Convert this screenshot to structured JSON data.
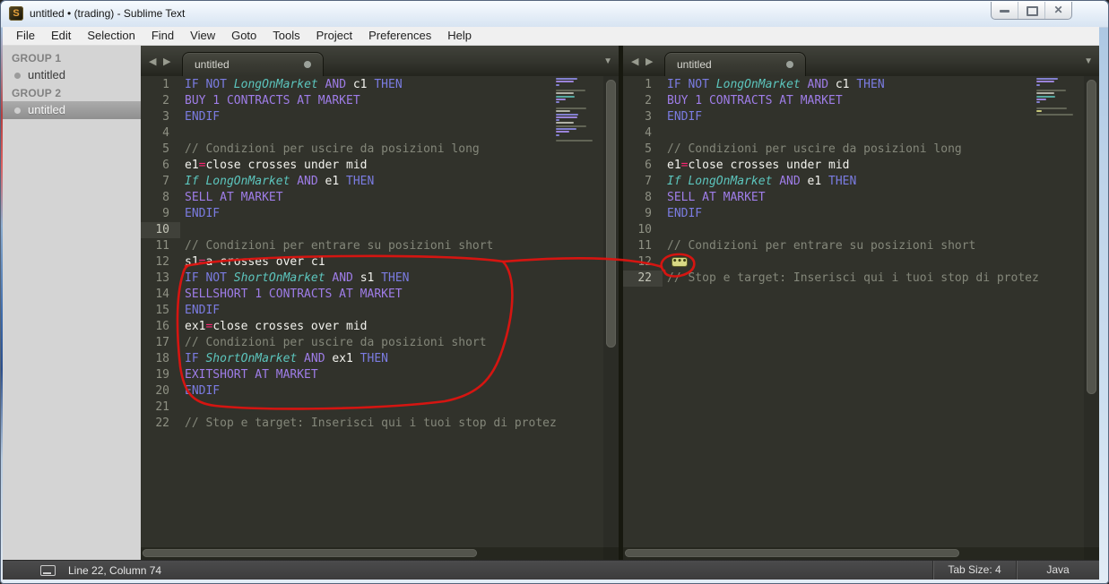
{
  "window": {
    "title": "untitled • (trading) - Sublime Text",
    "controls": {
      "minimize": "minimize",
      "maximize": "maximize",
      "close": "close"
    }
  },
  "menu": {
    "items": [
      "File",
      "Edit",
      "Selection",
      "Find",
      "View",
      "Goto",
      "Tools",
      "Project",
      "Preferences",
      "Help"
    ]
  },
  "sidebar": {
    "groups": [
      {
        "label": "GROUP 1",
        "items": [
          {
            "label": "untitled",
            "selected": false
          }
        ]
      },
      {
        "label": "GROUP 2",
        "items": [
          {
            "label": "untitled",
            "selected": true
          }
        ]
      }
    ]
  },
  "code_lines": {
    "1": [
      [
        "k",
        "IF NOT "
      ],
      [
        "it",
        "LongOnMarket"
      ],
      [
        "k2",
        " AND "
      ],
      [
        "v",
        "c1"
      ],
      [
        "k",
        " THEN"
      ]
    ],
    "2": [
      [
        "k2",
        "BUY 1 CONTRACTS AT MARKET"
      ]
    ],
    "3": [
      [
        "k",
        "ENDIF"
      ]
    ],
    "4": [],
    "5": [
      [
        "c",
        "// Condizioni per uscire da posizioni long"
      ]
    ],
    "6": [
      [
        "v",
        "e1"
      ],
      [
        "op",
        "="
      ],
      [
        "v",
        "close crosses under mid"
      ]
    ],
    "7": [
      [
        "it",
        "If LongOnMarket"
      ],
      [
        "k2",
        " AND "
      ],
      [
        "v",
        "e1"
      ],
      [
        "k",
        " THEN"
      ]
    ],
    "8": [
      [
        "k2",
        "SELL AT MARKET"
      ]
    ],
    "9": [
      [
        "k",
        "ENDIF"
      ]
    ],
    "10": [],
    "11": [
      [
        "c",
        "// Condizioni per entrare su posizioni short"
      ]
    ],
    "12": [
      [
        "v",
        "s1"
      ],
      [
        "op",
        "="
      ],
      [
        "v",
        "a crosses over c1"
      ]
    ],
    "13": [
      [
        "k",
        "IF NOT "
      ],
      [
        "it",
        "ShortOnMarket"
      ],
      [
        "k2",
        " AND "
      ],
      [
        "v",
        "s1"
      ],
      [
        "k",
        " THEN"
      ]
    ],
    "14": [
      [
        "k2",
        "SELLSHORT 1 CONTRACTS AT MARKET"
      ]
    ],
    "15": [
      [
        "k",
        "ENDIF"
      ]
    ],
    "16": [
      [
        "v",
        "ex1"
      ],
      [
        "op",
        "="
      ],
      [
        "v",
        "close crosses over mid"
      ]
    ],
    "17": [
      [
        "c",
        "// Condizioni per uscire da posizioni short"
      ]
    ],
    "18": [
      [
        "k",
        "IF "
      ],
      [
        "it",
        "ShortOnMarket"
      ],
      [
        "k2",
        " AND "
      ],
      [
        "v",
        "ex1"
      ],
      [
        "k",
        " THEN"
      ]
    ],
    "19": [
      [
        "k2",
        "EXITSHORT AT MARKET"
      ]
    ],
    "20": [
      [
        "k",
        "ENDIF"
      ]
    ],
    "21": [],
    "22": [
      [
        "c",
        "// Stop e target: Inserisci qui i tuoi stop di protez"
      ]
    ]
  },
  "panes": [
    {
      "tab": {
        "label": "untitled",
        "modified": true
      },
      "current_line": 10,
      "rows": [
        {
          "line": 1
        },
        {
          "line": 2
        },
        {
          "line": 3
        },
        {
          "line": 4
        },
        {
          "line": 5
        },
        {
          "line": 6
        },
        {
          "line": 7
        },
        {
          "line": 8
        },
        {
          "line": 9
        },
        {
          "line": 10
        },
        {
          "line": 11
        },
        {
          "line": 12
        },
        {
          "line": 13
        },
        {
          "line": 14
        },
        {
          "line": 15
        },
        {
          "line": 16
        },
        {
          "line": 17
        },
        {
          "line": 18
        },
        {
          "line": 19
        },
        {
          "line": 20
        },
        {
          "line": 21
        },
        {
          "line": 22
        }
      ]
    },
    {
      "tab": {
        "label": "untitled",
        "modified": true
      },
      "current_line": 22,
      "rows": [
        {
          "line": 1
        },
        {
          "line": 2
        },
        {
          "line": 3
        },
        {
          "line": 4
        },
        {
          "line": 5
        },
        {
          "line": 6
        },
        {
          "line": 7
        },
        {
          "line": 8
        },
        {
          "line": 9
        },
        {
          "line": 10
        },
        {
          "line": 11
        },
        {
          "line": 12,
          "folded": true
        },
        {
          "line": 22
        }
      ]
    }
  ],
  "status_bar": {
    "position": "Line 22, Column 74",
    "tab_size": "Tab Size: 4",
    "syntax": "Java"
  },
  "annotation": {
    "color": "#de1410",
    "note": "hand-drawn red loop around lines 12-20 of left pane with connector line to circled fold icon on line 12 of right pane"
  },
  "colors": {
    "editor_bg": "#31322b",
    "keyword_blue": "#7b7ce2",
    "keyword_violet": "#9f7de8",
    "identifier_teal": "#5cc5bd",
    "plain_text": "#f3f3ee",
    "operator_pink": "#f92672",
    "comment_gray": "#84877a"
  }
}
